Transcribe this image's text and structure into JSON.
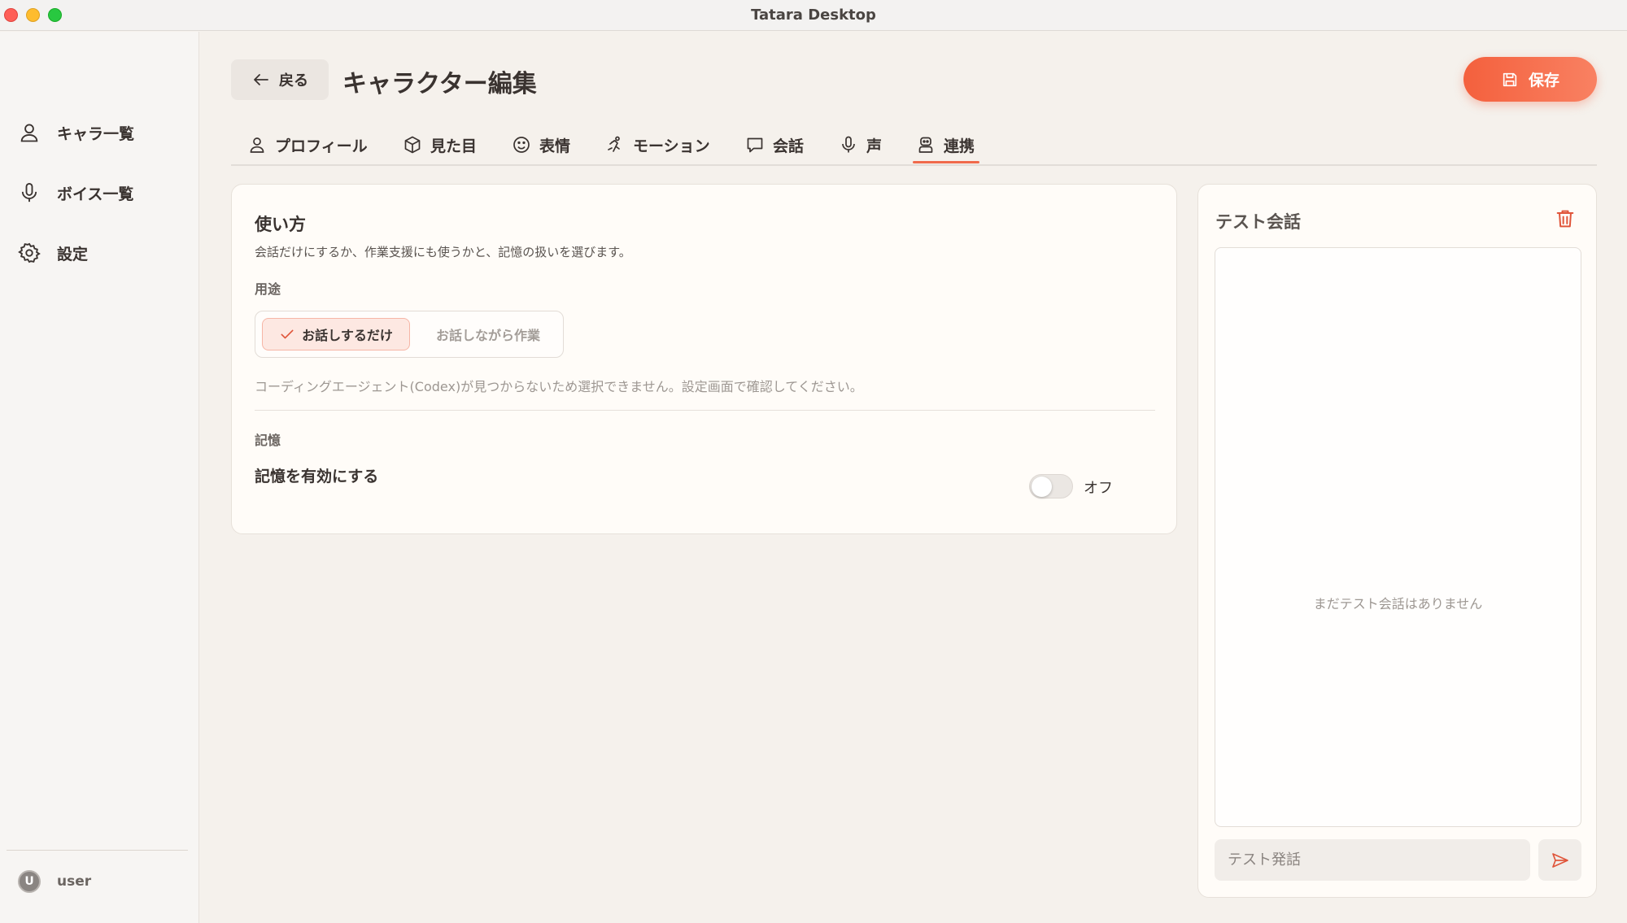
{
  "window": {
    "title": "Tatara Desktop"
  },
  "sidebar": {
    "items": [
      {
        "label": "キャラ一覧",
        "icon": "user-icon"
      },
      {
        "label": "ボイス一覧",
        "icon": "microphone-icon"
      },
      {
        "label": "設定",
        "icon": "gear-icon"
      }
    ],
    "user": {
      "avatar_initial": "U",
      "name": "user"
    }
  },
  "header": {
    "back_label": "戻る",
    "title": "キャラクター編集",
    "save_label": "保存"
  },
  "tabs": [
    {
      "label": "プロフィール",
      "icon": "user-icon"
    },
    {
      "label": "見た目",
      "icon": "cube-icon"
    },
    {
      "label": "表情",
      "icon": "smile-icon"
    },
    {
      "label": "モーション",
      "icon": "motion-icon"
    },
    {
      "label": "会話",
      "icon": "chat-bubble-icon"
    },
    {
      "label": "声",
      "icon": "microphone-icon"
    },
    {
      "label": "連携",
      "icon": "robot-icon",
      "active": true
    }
  ],
  "usage": {
    "title": "使い方",
    "subtitle": "会話だけにするか、作業支援にも使うかと、記憶の扱いを選びます。",
    "purpose_label": "用途",
    "options": [
      {
        "label": "お話しするだけ",
        "selected": true
      },
      {
        "label": "お話しながら作業",
        "selected": false,
        "disabled": true
      }
    ],
    "note": "コーディングエージェント(Codex)が見つからないため選択できません。設定画面で確認してください。",
    "memory_label": "記憶",
    "memory_setting": "記憶を有効にする",
    "memory_toggle_state": "オフ"
  },
  "test_chat": {
    "title": "テスト会話",
    "empty_message": "まだテスト会話はありません",
    "input_placeholder": "テスト発話"
  },
  "colors": {
    "accent": "#f06a4b",
    "background": "#f5f1ec",
    "card": "#fffcf8"
  }
}
